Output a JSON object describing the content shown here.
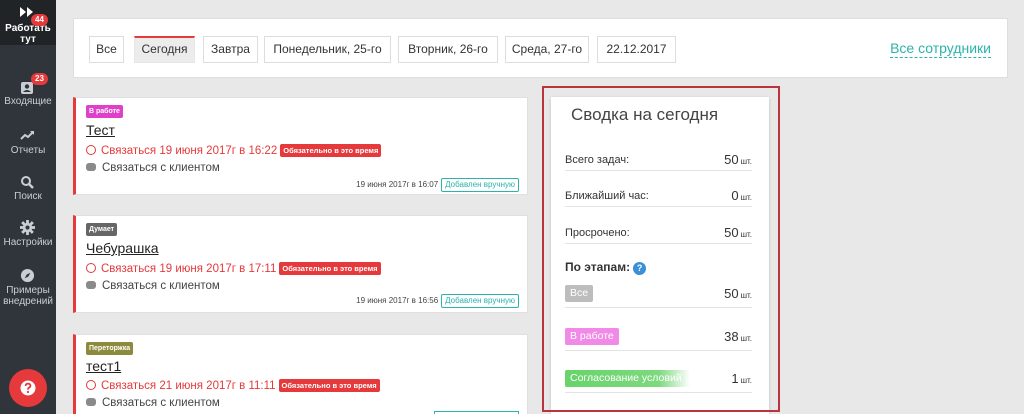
{
  "sidebar": {
    "items": [
      {
        "label": "Работать тут",
        "badge": "44",
        "icon": "fast-forward-icon"
      },
      {
        "label": "Входящие",
        "badge": "23",
        "icon": "inbox-user-icon"
      },
      {
        "label": "Отчеты",
        "icon": "trend-up-icon"
      },
      {
        "label": "Поиск",
        "icon": "search-icon"
      },
      {
        "label": "Настройки",
        "icon": "gear-icon"
      },
      {
        "label": "Примеры внедрений",
        "icon": "compass-icon"
      }
    ],
    "help_icon": "question-icon"
  },
  "filters": {
    "buttons": [
      "Все",
      "Сегодня",
      "Завтра",
      "Понедельник, 25-го",
      "Вторник, 26-го",
      "Среда, 27-го",
      "22.12.2017"
    ],
    "active": "Сегодня",
    "all_staff": "Все сотрудники"
  },
  "tasks": [
    {
      "tag": "В работе",
      "tag_color": "#e040c8",
      "title": "Тест",
      "when": "Связаться 19 июня 2017г в 16:22",
      "must": "Обязательно в это время",
      "action": "Связаться с клиентом",
      "meta": "19 июня 2017г в 16:07",
      "added": "Добавлен вручную"
    },
    {
      "tag": "Думает",
      "tag_color": "#666666",
      "title": "Чебурашка",
      "when": "Связаться 19 июня 2017г в 17:11",
      "must": "Обязательно в это время",
      "action": "Связаться с клиентом",
      "meta": "19 июня 2017г в 16:56",
      "added": "Добавлен вручную"
    },
    {
      "tag": "Переторжка",
      "tag_color": "#8c8a3c",
      "title": "тест1",
      "when": "Связаться 21 июня 2017г в 11:11",
      "must": "Обязательно в это время",
      "action": "Связаться с клиентом",
      "meta": "",
      "added": ""
    }
  ],
  "summary": {
    "title": "Сводка на сегодня",
    "rows": [
      {
        "label": "Всего задач:",
        "value": "50",
        "unit": "шт."
      },
      {
        "label": "Ближайший час:",
        "value": "0",
        "unit": "шт."
      },
      {
        "label": "Просрочено:",
        "value": "50",
        "unit": "шт."
      }
    ],
    "stages_label": "По этапам:",
    "stages": [
      {
        "label": "Все",
        "value": "50",
        "unit": "шт.",
        "color": "#bdbdbd"
      },
      {
        "label": "В работе",
        "value": "38",
        "unit": "шт.",
        "color": "#f08ae6"
      },
      {
        "label": "Согласование условий",
        "value": "1",
        "unit": "шт.",
        "color": "#68d46a"
      }
    ]
  }
}
